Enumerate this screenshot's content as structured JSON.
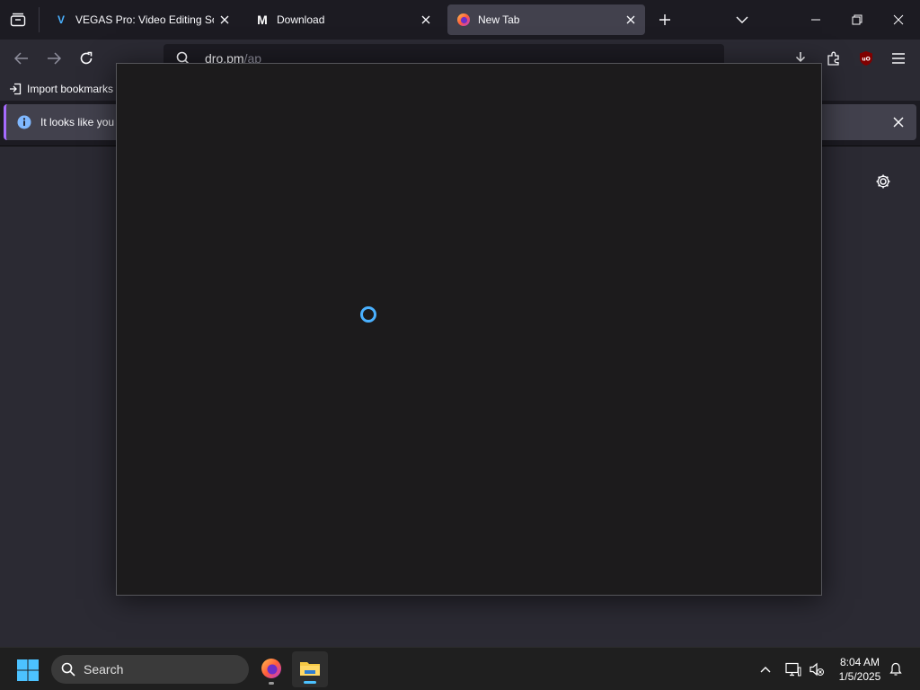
{
  "browser": {
    "tabs": [
      {
        "favicon": "vegas-v-icon",
        "favicon_text": "V",
        "title": "VEGAS Pro: Video Editing Softw",
        "active": false
      },
      {
        "favicon": "m-logo-icon",
        "favicon_text": "M",
        "title": "Download",
        "active": false
      },
      {
        "favicon": "firefox-icon",
        "favicon_text": "",
        "title": "New Tab",
        "active": true
      }
    ],
    "url": {
      "host": "dro.pm",
      "path": "/ap"
    },
    "bookmarks": {
      "import_label": "Import bookmarks"
    },
    "notification": {
      "text": "It looks like you h"
    }
  },
  "taskbar": {
    "search_placeholder": "Search",
    "time": "8:04 AM",
    "date": "1/5/2025"
  },
  "colors": {
    "spinner": "#4ab1ff",
    "notice_accent": "#a66bff",
    "active_tab": "#42414d"
  }
}
